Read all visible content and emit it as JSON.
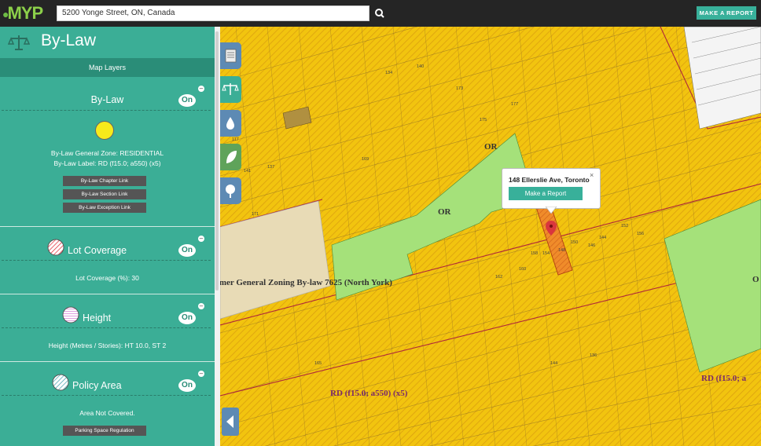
{
  "app": {
    "logo_text": "MYP",
    "brand_color": "#3bae96"
  },
  "search": {
    "value": "5200 Yonge Street, ON, Canada",
    "icon": "search-icon"
  },
  "header": {
    "report_button": "MAKE A REPORT"
  },
  "sidebar": {
    "title": "By-Law",
    "title_icon": "scale-icon",
    "map_layers_label": "Map Layers",
    "sections": [
      {
        "title": "By-Law",
        "toggle": "On",
        "swatch_color": "#f7ea1b",
        "info_lines": [
          "By-Law General Zone: RESIDENTIAL",
          "By-Law Label: RD (f15.0; a550) (x5)"
        ],
        "links": [
          "By-Law Chapter Link",
          "By-Law Section Link",
          "By-Law Exception Link"
        ]
      },
      {
        "title": "Lot Coverage",
        "toggle": "On",
        "info": "Lot Coverage (%): 30"
      },
      {
        "title": "Height",
        "toggle": "On",
        "info": "Height (Metres / Stories): HT 10.0, ST 2"
      },
      {
        "title": "Policy Area",
        "toggle": "On",
        "info": "Area Not Covered.",
        "links": [
          "Parking Space Regulation"
        ]
      }
    ]
  },
  "map": {
    "tools": [
      "document-icon",
      "scale-icon",
      "water-drop-icon",
      "leaf-icon",
      "tree-icon"
    ],
    "popup": {
      "address": "148 Ellerslie Ave, Toronto",
      "button": "Make a Report",
      "close": "×"
    },
    "labels": {
      "or1": "OR",
      "or2": "OR",
      "or3": "O",
      "former_zoning": "rmer General Zoning By-law 7625 (North York)",
      "rd1": "RD (f15.0; a550) (x5)",
      "rd2": "RD (f15.0; a"
    },
    "lot_numbers": [
      "148",
      "150",
      "154",
      "156",
      "152",
      "144",
      "146",
      "158",
      "160",
      "162",
      "165",
      "171",
      "173",
      "175",
      "177"
    ],
    "colors": {
      "residential": "#f2c40f",
      "open_space": "#a5e17a",
      "selected": "#f08c2a",
      "former": "#e8dbb6"
    }
  }
}
